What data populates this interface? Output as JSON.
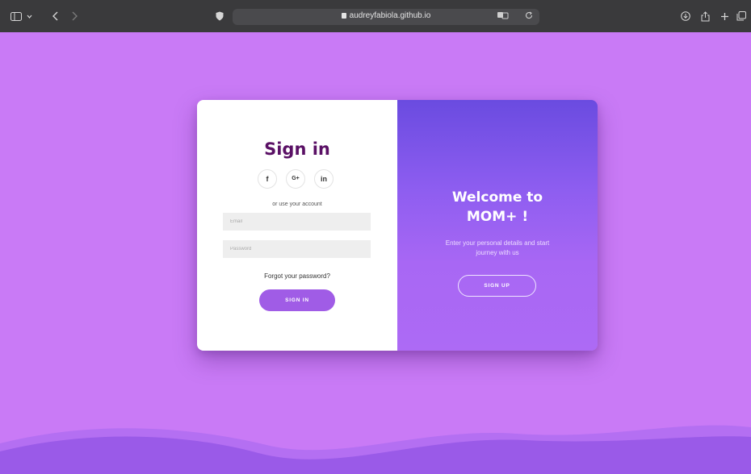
{
  "browser": {
    "url": "audreyfabiola.github.io",
    "icons": [
      "sidebar-icon",
      "chevron-down-icon",
      "back-icon",
      "forward-icon",
      "shield-icon",
      "lock-icon",
      "translate-icon",
      "reload-icon",
      "download-icon",
      "share-icon",
      "new-tab-icon",
      "tabs-overview-icon"
    ]
  },
  "signin": {
    "title": "Sign in",
    "social": [
      {
        "label": "f",
        "icon": "facebook-icon"
      },
      {
        "label": "G+",
        "icon": "google-plus-icon"
      },
      {
        "label": "in",
        "icon": "linkedin-icon"
      }
    ],
    "or_text": "or use your account",
    "email_placeholder": "Email",
    "password_placeholder": "Password",
    "forgot_label": "Forgot your password?",
    "button_label": "SIGN IN"
  },
  "welcome": {
    "title_line1": "Welcome to",
    "title_line2": "MOM+ !",
    "subtitle_line1": "Enter your personal details and start",
    "subtitle_line2": "journey with us",
    "button_label": "SIGN UP"
  },
  "colors": {
    "background": "#c97af6",
    "title": "#5a1065",
    "accent": "#a05ce6",
    "gradient_top": "#6a4be0",
    "gradient_bottom": "#ad6af5"
  }
}
